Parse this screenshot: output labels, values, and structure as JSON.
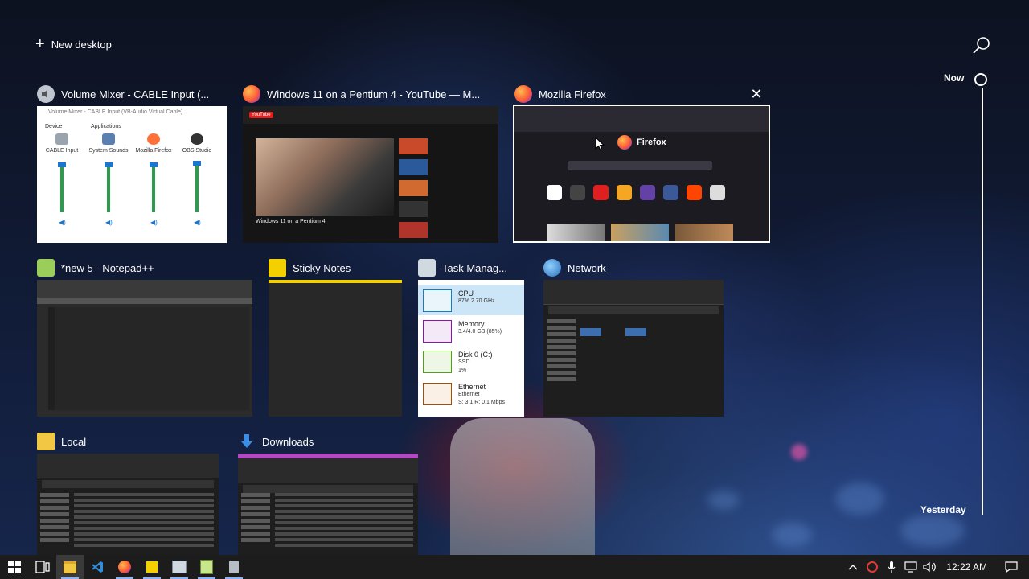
{
  "top": {
    "new_desktop_label": "New desktop"
  },
  "windows": [
    {
      "id": "volume-mixer",
      "title": "Volume Mixer - CABLE Input (...",
      "icon": "speaker-icon"
    },
    {
      "id": "youtube",
      "title": "Windows 11 on a Pentium 4 - YouTube — M...",
      "icon": "firefox-icon"
    },
    {
      "id": "firefox",
      "title": "Mozilla Firefox",
      "icon": "firefox-icon",
      "selected": true
    },
    {
      "id": "notepad",
      "title": "*new 5 - Notepad++",
      "icon": "notepad-plus-plus-icon"
    },
    {
      "id": "sticky",
      "title": "Sticky Notes",
      "icon": "sticky-notes-icon"
    },
    {
      "id": "taskmgr",
      "title": "Task Manag...",
      "icon": "task-manager-icon"
    },
    {
      "id": "network",
      "title": "Network",
      "icon": "network-icon"
    },
    {
      "id": "local",
      "title": "Local",
      "icon": "folder-icon"
    },
    {
      "id": "downloads",
      "title": "Downloads",
      "icon": "downloads-folder-icon"
    }
  ],
  "volume_mixer": {
    "window_title": "Volume Mixer - CABLE Input (VB-Audio Virtual Cable)",
    "device_header": "Device",
    "apps_header": "Applications",
    "channels": [
      {
        "name": "CABLE Input",
        "level": 0.95
      },
      {
        "name": "System Sounds",
        "level": 0.95
      },
      {
        "name": "Mozilla Firefox",
        "level": 0.95
      },
      {
        "name": "OBS Studio",
        "level": 0.97
      }
    ]
  },
  "youtube": {
    "video_title": "Windows 11 on a Pentium 4",
    "logo": "YouTube"
  },
  "firefox": {
    "brand": "Firefox"
  },
  "task_manager": {
    "items": [
      {
        "name": "CPU",
        "detail": "87% 2.70 GHz",
        "color": "#117dbb"
      },
      {
        "name": "Memory",
        "detail": "3.4/4.0 GB (85%)",
        "color": "#8b12ae"
      },
      {
        "name": "Disk 0 (C:)",
        "detail": "SSD",
        "detail2": "1%",
        "color": "#4da60c"
      },
      {
        "name": "Ethernet",
        "detail": "Ethernet",
        "detail2": "S: 3.1 R: 0.1 Mbps",
        "color": "#a74f01"
      }
    ]
  },
  "timeline": {
    "now_label": "Now",
    "yesterday_label": "Yesterday"
  },
  "taskbar": {
    "clock": "12:22 AM"
  }
}
